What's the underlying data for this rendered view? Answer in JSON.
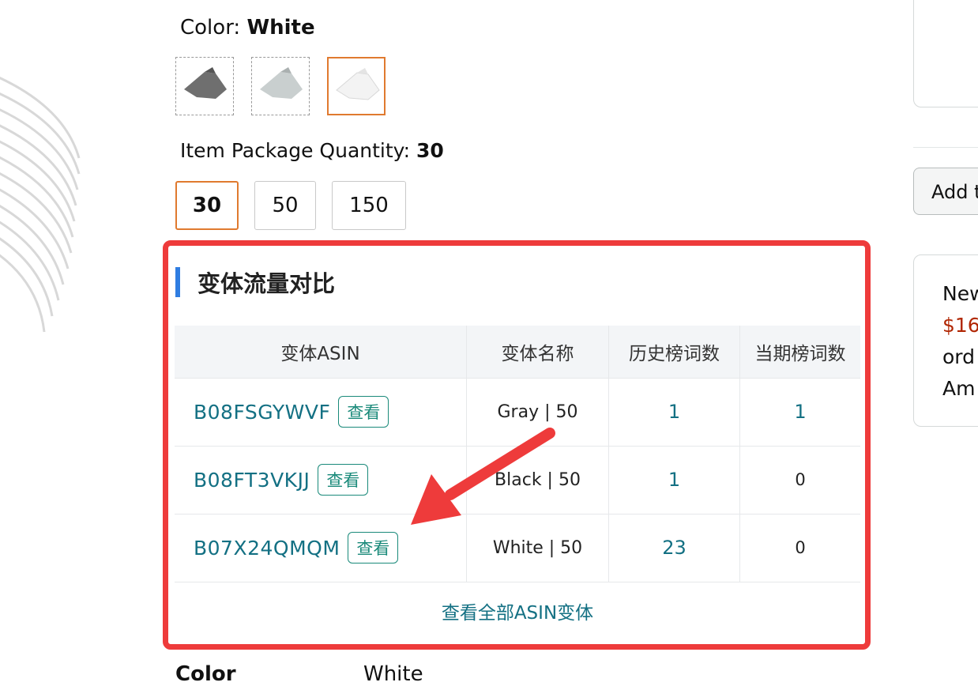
{
  "color": {
    "label": "Color: ",
    "value": "White"
  },
  "swatches": [
    {
      "name": "Gray",
      "fill": "#6f6f6f"
    },
    {
      "name": "Light Gray",
      "fill": "#c9cfcf"
    },
    {
      "name": "White",
      "fill": "#f3f3f3",
      "selected": true
    }
  ],
  "quantity": {
    "label": "Item Package Quantity: ",
    "value": "30",
    "options": [
      "30",
      "50",
      "150"
    ],
    "selected": "30"
  },
  "panel": {
    "title": "变体流量对比",
    "columns": [
      "变体ASIN",
      "变体名称",
      "历史榜词数",
      "当期榜词数"
    ],
    "rows": [
      {
        "asin": "B08FSGYWVF",
        "view": "查看",
        "name": "Gray | 50",
        "history": "1",
        "current": "1"
      },
      {
        "asin": "B08FT3VKJJ",
        "view": "查看",
        "name": "Black | 50",
        "history": "1",
        "current": "0"
      },
      {
        "asin": "B07X24QMQM",
        "view": "查看",
        "name": "White | 50",
        "history": "23",
        "current": "0"
      }
    ],
    "view_all": "查看全部ASIN变体"
  },
  "right": {
    "add_button": "Add t",
    "new_lines": [
      "New",
      "$16",
      "ord",
      "Am"
    ]
  },
  "bottom": {
    "color_label": "Color",
    "color_value": "White"
  },
  "colors": {
    "accent_orange": "#e07a2f",
    "link_teal": "#137083",
    "highlight_red": "#ee3b3b",
    "title_bar_blue": "#2f7de1"
  }
}
